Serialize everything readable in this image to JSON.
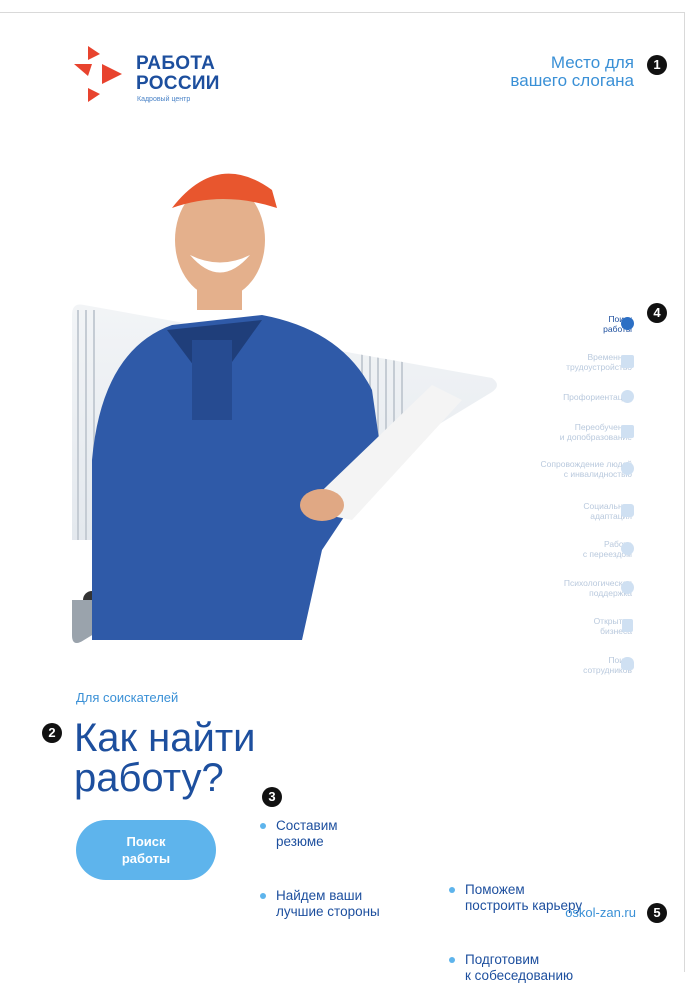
{
  "logo": {
    "line1": "РАБОТА",
    "line2": "РОССИИ",
    "subtitle": "Кадровый центр"
  },
  "slogan": {
    "line1": "Место для",
    "line2": "вашего слогана"
  },
  "markers": [
    "1",
    "2",
    "3",
    "4",
    "5"
  ],
  "services": [
    {
      "line1": "Поиск",
      "line2": "работы",
      "icon": "search-play-icon",
      "active": true
    },
    {
      "line1": "Временное",
      "line2": "трудоустройство",
      "icon": "calendar-icon",
      "active": false
    },
    {
      "line1": "Профориентация",
      "line2": "",
      "icon": "compass-icon",
      "active": false
    },
    {
      "line1": "Переобучение",
      "line2": "и допобразование",
      "icon": "education-icon",
      "active": false
    },
    {
      "line1": "Сопровождение людей",
      "line2": "с инвалидностью",
      "icon": "accessibility-icon",
      "active": false
    },
    {
      "line1": "Социальная",
      "line2": "адаптация",
      "icon": "puzzle-icon",
      "active": false
    },
    {
      "line1": "Работа",
      "line2": "с переездом",
      "icon": "location-icon",
      "active": false
    },
    {
      "line1": "Психологическая",
      "line2": "поддержка",
      "icon": "chat-icon",
      "active": false
    },
    {
      "line1": "Открытие",
      "line2": "бизнеса",
      "icon": "document-icon",
      "active": false
    },
    {
      "line1": "Поиск",
      "line2": "сотрудников",
      "icon": "person-icon",
      "active": false
    }
  ],
  "audience": "Для соискателей",
  "headline": {
    "line1": "Как найти",
    "line2": "работу?"
  },
  "cta": {
    "line1": "Поиск",
    "line2": "работы"
  },
  "bullets": [
    {
      "line1": "Составим",
      "line2": "резюме"
    },
    {
      "line1": "Найдем ваши",
      "line2": "лучшие стороны"
    },
    {
      "line1": "Поможем",
      "line2": "построить карьеру"
    },
    {
      "line1": "Подготовим",
      "line2": "к собеседованию"
    }
  ],
  "website": "oskol-zan.ru",
  "colors": {
    "brand_blue": "#1d4f9e",
    "accent_blue": "#3a90d6",
    "cta_blue": "#5eb4ec",
    "logo_red": "#e8432e"
  }
}
